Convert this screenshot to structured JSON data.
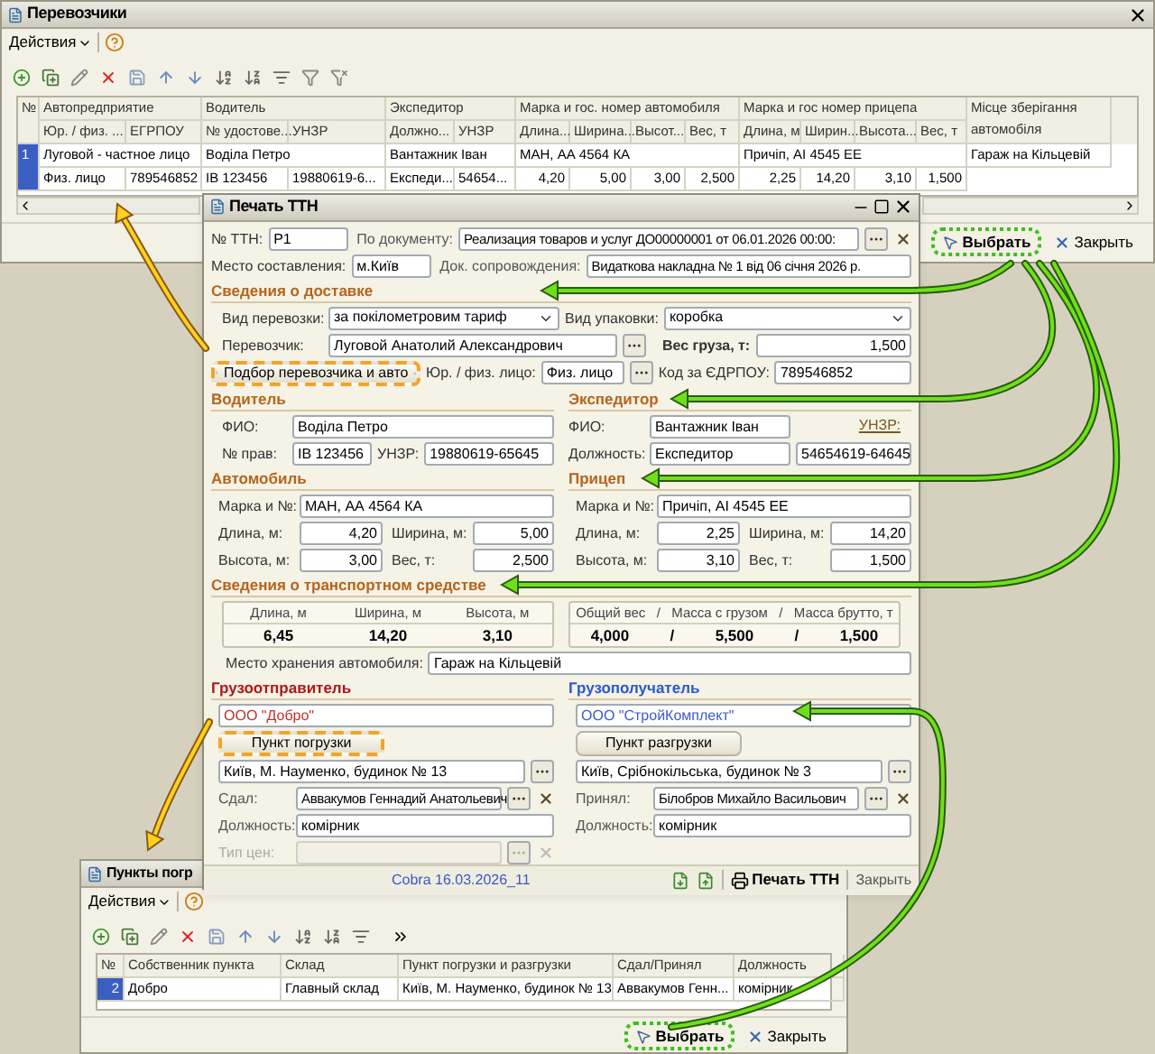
{
  "carriers_window": {
    "title": "Перевозчики",
    "menu_label": "Действия",
    "number_header": "№",
    "groups": [
      {
        "label": "Автопредприятие",
        "columns": [
          "Юр. / физ. ...",
          "ЕГРПОУ"
        ]
      },
      {
        "label": "Водитель",
        "columns": [
          "№ удостове...",
          "УНЗР"
        ]
      },
      {
        "label": "Экспедитор",
        "columns": [
          "Должно...",
          "УНЗР"
        ]
      },
      {
        "label": "Марка и гос. номер автомобиля",
        "columns": [
          "Длина...",
          "Ширина...",
          "Высот...",
          "Вес, т"
        ]
      },
      {
        "label": "Марка и гос номер прицепа",
        "columns": [
          "Длина, м",
          "Ширин...",
          "Высота...",
          "Вес, т"
        ]
      },
      {
        "label": "Місце зберігання автомобіля"
      }
    ],
    "rows": [
      {
        "number": "1",
        "selected": true,
        "cells": [
          {
            "text": "Луговой - частное лицо",
            "details": [
              "Физ. лицо",
              "789546852"
            ]
          },
          {
            "text": "Воділа Петро",
            "details": [
              "ІВ 123456",
              "19880619-6..."
            ]
          },
          {
            "text": "Вантажник Іван",
            "details": [
              "Експеди...",
              "54654..."
            ]
          },
          {
            "text": "МАН, АА 4564 КА",
            "details": [
              "4,20",
              "5,00",
              "3,00",
              "2,500"
            ]
          },
          {
            "text": "Причіп, АІ 4545 ЕЕ",
            "details": [
              "2,25",
              "14,20",
              "3,10",
              "1,500"
            ]
          },
          {
            "text": "Гараж на Кільцевій"
          }
        ]
      }
    ],
    "buttons": [
      {
        "label": "Выбрать",
        "kind": "select",
        "highlighted": true
      },
      {
        "label": "Закрыть",
        "kind": "close",
        "highlighted": false
      }
    ]
  },
  "print_window": {
    "title": "Печать ТТН",
    "ttn_number": {
      "label": "№ ТТН:",
      "value": "Р1"
    },
    "document": {
      "label": "По документу:",
      "value": "Реализация товаров и услуг ДО00000001 от 06.01.2026 00:00:"
    },
    "place": {
      "label": "Место составления:",
      "value": "м.Київ"
    },
    "accompanying_doc": {
      "label": "Док. сопровождения:",
      "value": "Видаткова накладна № 1 від 06 січня 2026 р."
    },
    "delivery": {
      "title": "Сведения о доставке",
      "transport_type": {
        "label": "Вид перевозки:",
        "value": "за покілометровим тариф"
      },
      "packaging": {
        "label": "Вид упаковки:",
        "value": "коробка"
      },
      "carrier": {
        "label": "Перевозчик:",
        "value": "Луговой Анатолий Александрович"
      },
      "cargo_weight": {
        "label": "Вес груза, т:",
        "value": "1,500"
      },
      "pick_button": {
        "label": "Подбор перевозчика и авто",
        "highlighted": true
      },
      "entity_type": {
        "label": "Юр. / физ. лицо:",
        "value": "Физ. лицо"
      },
      "code": {
        "label": "Код за ЄДРПОУ:",
        "value": "789546852"
      }
    },
    "driver": {
      "title": "Водитель",
      "name": {
        "label": "ФИО:",
        "value": "Воділа Петро"
      },
      "license": {
        "label": "№ прав:",
        "value": "ІВ 123456"
      },
      "unzr": {
        "label": "УНЗР:",
        "value": "19880619-65645"
      }
    },
    "forwarder": {
      "title": "Экспедитор",
      "name": {
        "label": "ФИО:",
        "value": "Вантажник Іван"
      },
      "unzr_link": "УНЗР:",
      "position": {
        "label": "Должность:",
        "value": "Експедитор"
      },
      "unzr_value": "54654619-64645"
    },
    "car": {
      "title": "Автомобиль",
      "brand": {
        "label": "Марка и №:",
        "value": "МАН, АА 4564 КА"
      },
      "dims": [
        {
          "label": "Длина, м:",
          "value": "4,20"
        },
        {
          "label": "Ширина, м:",
          "value": "5,00"
        },
        {
          "label": "Высота, м:",
          "value": "3,00"
        },
        {
          "label": "Вес, т:",
          "value": "2,500"
        }
      ]
    },
    "trailer": {
      "title": "Прицеп",
      "brand": {
        "label": "Марка и №:",
        "value": "Причіп, АІ 4545 ЕЕ"
      },
      "dims": [
        {
          "label": "Длина, м:",
          "value": "2,25"
        },
        {
          "label": "Ширина, м:",
          "value": "14,20"
        },
        {
          "label": "Высота, м:",
          "value": "3,10"
        },
        {
          "label": "Вес, т:",
          "value": "1,500"
        }
      ]
    },
    "vehicle_summary": {
      "title": "Сведения о транспортном средстве",
      "dimension_headers": [
        "Длина, м",
        "Ширина, м",
        "Высота, м"
      ],
      "dimension_values": [
        "6,45",
        "14,20",
        "3,10"
      ],
      "weight_headers": [
        "Общий вес",
        "/",
        "Масса с грузом",
        "/",
        "Масса брутто, т"
      ],
      "weight_values": [
        "4,000",
        "/",
        "5,500",
        "/",
        "1,500"
      ],
      "storage": {
        "label": "Место хранения автомобиля:",
        "value": "Гараж на Кільцевій"
      }
    },
    "shipper": {
      "title": "Грузоотправитель",
      "org": "ООО \"Добро\"",
      "point_button": {
        "label": "Пункт погрузки",
        "highlighted": true
      },
      "address": "Київ, М. Науменко, будинок № 13",
      "person": {
        "label": "Сдал:",
        "value": "Аввакумов Геннадий Анатольевич"
      },
      "position": {
        "label": "Должность:",
        "value": "комірник"
      },
      "price_type": {
        "label": "Тип цен:",
        "disabled": true
      }
    },
    "consignee": {
      "title": "Грузополучатель",
      "org": "ООО \"СтройКомплект\"",
      "point_button": {
        "label": "Пункт разгрузки",
        "highlighted": false
      },
      "address": "Київ, Срібнокільська, будинок № 3",
      "person": {
        "label": "Принял:",
        "value": "Білобров Михайло Васильович"
      },
      "position": {
        "label": "Должность:",
        "value": "комірник"
      }
    },
    "footer": {
      "version": "Cobra 16.03.2026_11",
      "print_button": "Печать ТТН",
      "close_button": "Закрыть"
    }
  },
  "points_window": {
    "title": "Пункты погр",
    "menu_label": "Действия",
    "columns": [
      "№",
      "Собственник пункта",
      "Склад",
      "Пункт погрузки и разгрузки",
      "Сдал/Принял",
      "Должность"
    ],
    "rows": [
      {
        "selected": true,
        "cells": [
          "2",
          "Добро",
          "Главный склад",
          "Київ, М. Науменко, будинок № 13",
          "Аввакумов Генн...",
          "комірник"
        ]
      }
    ],
    "buttons": [
      {
        "label": "Выбрать",
        "kind": "select",
        "highlighted": true
      },
      {
        "label": "Закрыть",
        "kind": "close",
        "highlighted": false
      }
    ]
  }
}
